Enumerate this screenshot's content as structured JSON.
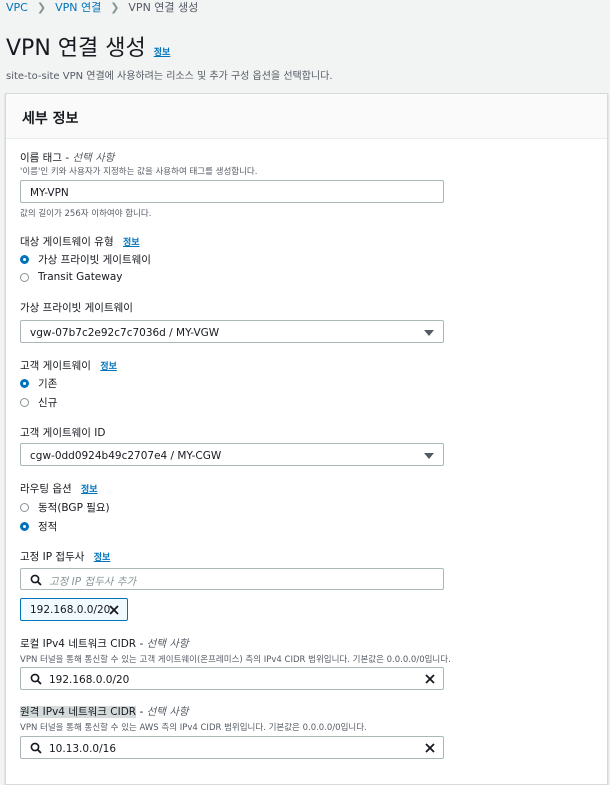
{
  "breadcrumb": {
    "items": [
      "VPC",
      "VPN 연결",
      "VPN 연결 생성"
    ]
  },
  "page": {
    "title": "VPN 연결 생성",
    "info": "정보",
    "subtitle": "site-to-site VPN 연결에 사용하려는 리소스 및 추가 구성 옵션을 선택합니다."
  },
  "panel": {
    "title": "세부 정보"
  },
  "name_tag": {
    "label": "이름 태그 - ",
    "optional": "선택 사항",
    "description": "'이름'인 키와 사용자가 지정하는 값을 사용하여 태그를 생성합니다.",
    "value": "MY-VPN",
    "constraint": "값의 길이가 256자 이하여야 합니다."
  },
  "target_gateway_type": {
    "label": "대상 게이트웨이 유형",
    "info": "정보",
    "options": [
      {
        "label": "가상 프라이빗 게이트웨이",
        "selected": true
      },
      {
        "label": "Transit Gateway",
        "selected": false
      }
    ]
  },
  "virtual_private_gateway": {
    "label": "가상 프라이빗 게이트웨이",
    "value": "vgw-07b7c2e92c7c7036d / MY-VGW"
  },
  "customer_gateway": {
    "label": "고객 게이트웨이",
    "info": "정보",
    "options": [
      {
        "label": "기존",
        "selected": true
      },
      {
        "label": "신규",
        "selected": false
      }
    ]
  },
  "customer_gateway_id": {
    "label": "고객 게이트웨이 ID",
    "value": "cgw-0dd0924b49c2707e4 / MY-CGW"
  },
  "routing_options": {
    "label": "라우팅 옵션",
    "info": "정보",
    "options": [
      {
        "label": "동적(BGP 필요)",
        "selected": false
      },
      {
        "label": "정적",
        "selected": true
      }
    ]
  },
  "static_ip_prefixes": {
    "label": "고정 IP 접두사",
    "info": "정보",
    "placeholder": "고정 IP 접두사 추가",
    "tokens": [
      "192.168.0.0/20"
    ]
  },
  "local_ipv4_cidr": {
    "label": "로컬 IPv4 네트워크 CIDR - ",
    "optional": "선택 사항",
    "description": "VPN 터널을 통해 통신할 수 있는 고객 게이트웨이(온프레미스) 측의 IPv4 CIDR 범위입니다. 기본값은 0.0.0.0/0입니다.",
    "value": "192.168.0.0/20"
  },
  "remote_ipv4_cidr": {
    "label": "원격 IPv4 네트워크 CIDR",
    "label_suffix": " - ",
    "optional": "선택 사항",
    "description": "VPN 터널을 통해 통신할 수 있는 AWS 측의 IPv4 CIDR 범위입니다. 기본값은 0.0.0.0/0입니다.",
    "value": "10.13.0.0/16"
  },
  "colors": {
    "link": "#0073bb",
    "text": "#16191f",
    "muted": "#545b64",
    "border": "#aab7b8"
  }
}
